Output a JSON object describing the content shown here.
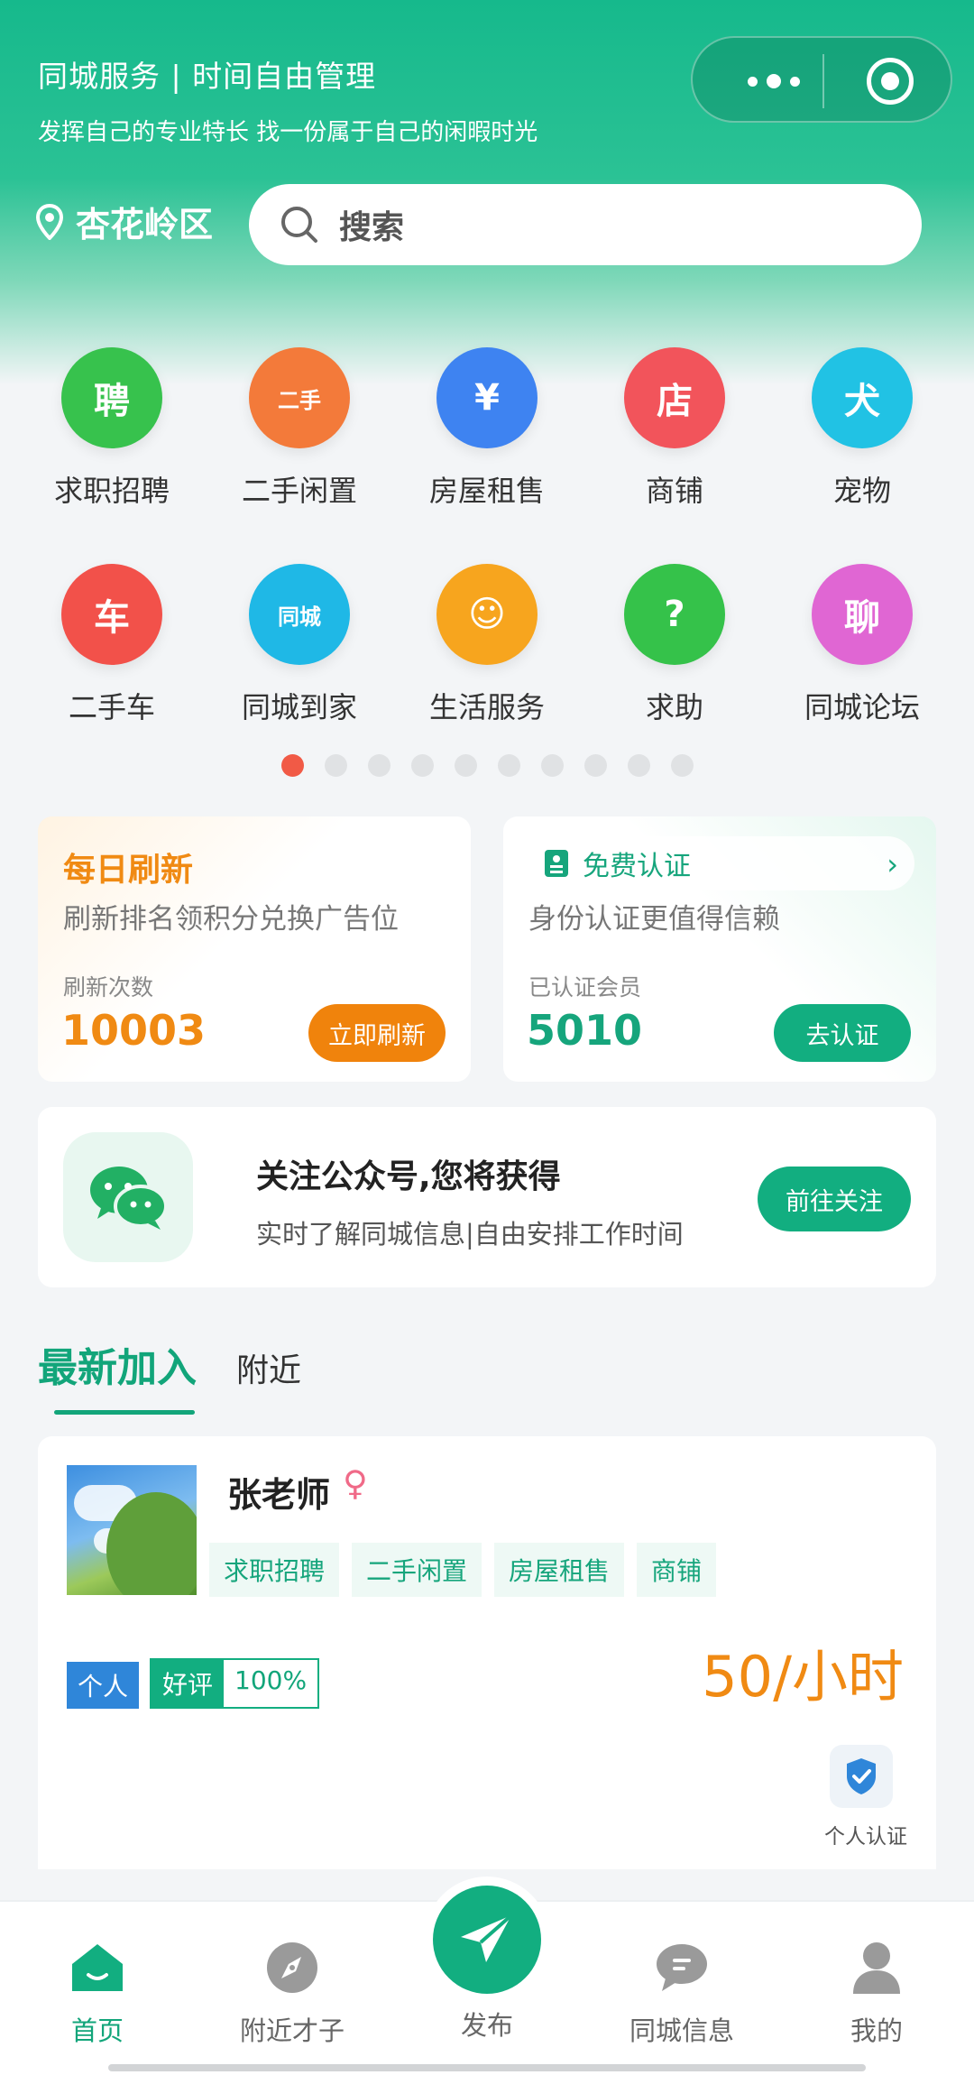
{
  "header": {
    "title": "同城服务 | 时间自由管理",
    "subtitle": "发挥自己的专业特长 找一份属于自己的闲暇时光",
    "location": "杏花岭区",
    "search_placeholder": "搜索"
  },
  "categories": [
    {
      "label": "求职招聘",
      "icon": "hire-icon",
      "color": "#37c24d",
      "glyph": "聘"
    },
    {
      "label": "二手闲置",
      "icon": "secondhand-icon",
      "color": "#f37a3a",
      "glyph": "二手"
    },
    {
      "label": "房屋租售",
      "icon": "house-icon",
      "color": "#3e83f1",
      "glyph": "¥"
    },
    {
      "label": "商铺",
      "icon": "shop-icon",
      "color": "#f2545b",
      "glyph": "店"
    },
    {
      "label": "宠物",
      "icon": "pet-icon",
      "color": "#21c2e4",
      "glyph": "犬"
    },
    {
      "label": "二手车",
      "icon": "car-icon",
      "color": "#f2514a",
      "glyph": "车"
    },
    {
      "label": "同城到家",
      "icon": "local-home-icon",
      "color": "#1fb8e6",
      "glyph": "同城"
    },
    {
      "label": "生活服务",
      "icon": "life-service-icon",
      "color": "#f7a51e",
      "glyph": "☺"
    },
    {
      "label": "求助",
      "icon": "help-icon",
      "color": "#35c24a",
      "glyph": "?"
    },
    {
      "label": "同城论坛",
      "icon": "forum-icon",
      "color": "#e066d3",
      "glyph": "聊"
    }
  ],
  "pager": {
    "count": 10,
    "active": 0
  },
  "refresh_card": {
    "title": "每日刷新",
    "desc": "刷新排名领积分兑换广告位",
    "count_label": "刷新次数",
    "count": "10003",
    "button": "立即刷新"
  },
  "cert_card": {
    "title": "免费认证",
    "desc": "身份认证更值得信赖",
    "count_label": "已认证会员",
    "count": "5010",
    "button": "去认证"
  },
  "follow_card": {
    "title": "关注公众号,您将获得",
    "desc": "实时了解同城信息|自由安排工作时间",
    "button": "前往关注"
  },
  "tabs": [
    "最新加入",
    "附近"
  ],
  "listing": {
    "name": "张老师",
    "gender_symbol": "♀",
    "tags": [
      "求职招聘",
      "二手闲置",
      "房屋租售",
      "商铺"
    ],
    "type_badge": "个人",
    "review_label": "好评",
    "review_value": "100%",
    "price": "50/小时",
    "verify_label": "个人认证"
  },
  "nav": {
    "home": "首页",
    "nearby": "附近才子",
    "publish": "发布",
    "info": "同城信息",
    "mine": "我的"
  },
  "colors": {
    "primary": "#12ae80",
    "accent": "#f08a13"
  }
}
